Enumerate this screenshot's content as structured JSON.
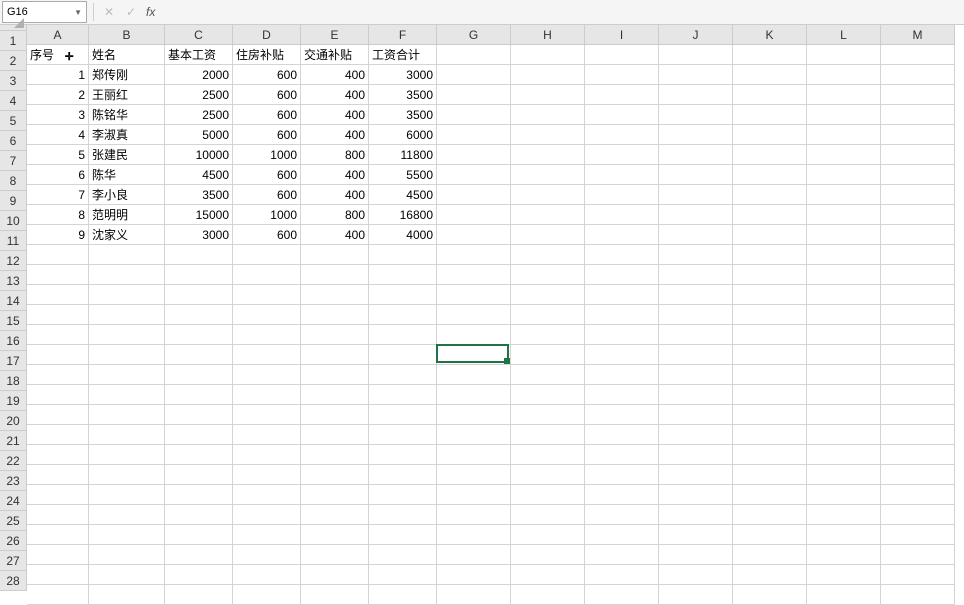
{
  "nameBox": {
    "value": "G16"
  },
  "formulaBar": {
    "fxLabel": "fx",
    "value": ""
  },
  "columns": [
    {
      "label": "A",
      "width": 62
    },
    {
      "label": "B",
      "width": 76
    },
    {
      "label": "C",
      "width": 68
    },
    {
      "label": "D",
      "width": 68
    },
    {
      "label": "E",
      "width": 68
    },
    {
      "label": "F",
      "width": 68
    },
    {
      "label": "G",
      "width": 74
    },
    {
      "label": "H",
      "width": 74
    },
    {
      "label": "I",
      "width": 74
    },
    {
      "label": "J",
      "width": 74
    },
    {
      "label": "K",
      "width": 74
    },
    {
      "label": "L",
      "width": 74
    },
    {
      "label": "M",
      "width": 74
    }
  ],
  "rowCount": 28,
  "headers": [
    "序号",
    "姓名",
    "基本工资",
    "住房补贴",
    "交通补贴",
    "工资合计"
  ],
  "data": [
    {
      "seq": 1,
      "name": "郑传刚",
      "base": 2000,
      "housing": 600,
      "transport": 400,
      "total": 3000
    },
    {
      "seq": 2,
      "name": "王丽红",
      "base": 2500,
      "housing": 600,
      "transport": 400,
      "total": 3500
    },
    {
      "seq": 3,
      "name": "陈铭华",
      "base": 2500,
      "housing": 600,
      "transport": 400,
      "total": 3500
    },
    {
      "seq": 4,
      "name": "李淑真",
      "base": 5000,
      "housing": 600,
      "transport": 400,
      "total": 6000
    },
    {
      "seq": 5,
      "name": "张建民",
      "base": 10000,
      "housing": 1000,
      "transport": 800,
      "total": 11800
    },
    {
      "seq": 6,
      "name": "陈华",
      "base": 4500,
      "housing": 600,
      "transport": 400,
      "total": 5500
    },
    {
      "seq": 7,
      "name": "李小良",
      "base": 3500,
      "housing": 600,
      "transport": 400,
      "total": 4500
    },
    {
      "seq": 8,
      "name": "范明明",
      "base": 15000,
      "housing": 1000,
      "transport": 800,
      "total": 16800
    },
    {
      "seq": 9,
      "name": "沈家义",
      "base": 3000,
      "housing": 600,
      "transport": 400,
      "total": 4000
    }
  ],
  "activeCell": {
    "col": 6,
    "row": 15
  },
  "cursor": {
    "visibleAt": {
      "row": 0,
      "col": 0,
      "glyph": "✛",
      "offsetX": 38,
      "offsetY": 3
    }
  }
}
